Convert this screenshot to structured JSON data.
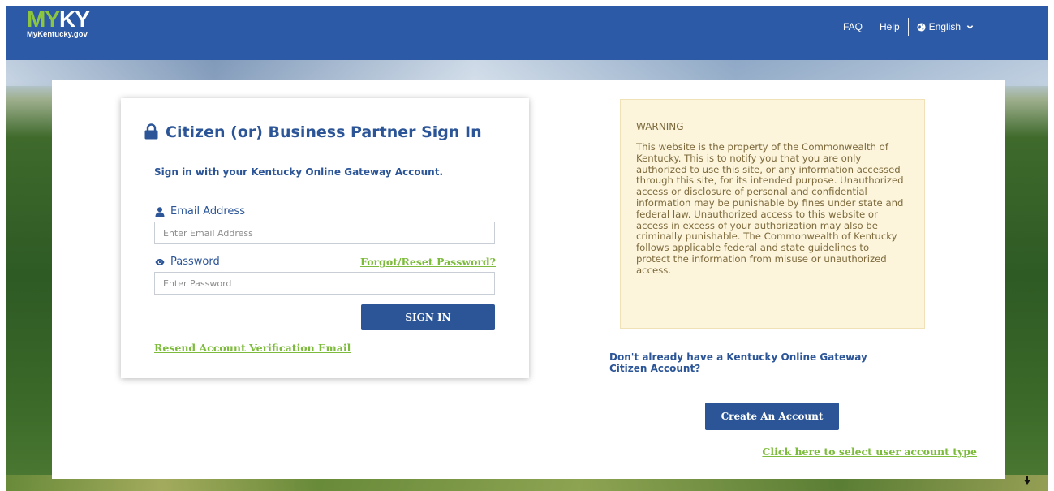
{
  "header": {
    "logo_my": "MY",
    "logo_ky": "KY",
    "logo_sub": "MyKentucky.gov",
    "nav": {
      "faq": "FAQ",
      "help": "Help",
      "language": "English"
    }
  },
  "signin": {
    "title": "Citizen (or) Business Partner Sign In",
    "subtitle": "Sign in with your Kentucky Online Gateway Account.",
    "email_label": "Email Address",
    "email_placeholder": "Enter Email Address",
    "email_value": "",
    "password_label": "Password",
    "password_placeholder": "Enter Password",
    "password_value": "",
    "forgot_link": "Forgot/Reset Password?",
    "signin_button": "SIGN IN",
    "resend_link": "Resend Account Verification Email"
  },
  "warning": {
    "title": "WARNING",
    "body": "This website is the property of the Commonwealth of Kentucky. This is to notify you that you are only authorized to use this site, or any information accessed through this site, for its intended purpose. Unauthorized access or disclosure of personal and confidential information may be punishable by fines under state and federal law. Unauthorized access to this website or access in excess of your authorization may also be criminally punishable. The Commonwealth of Kentucky follows applicable federal and state guidelines to protect the information from misuse or unauthorized access."
  },
  "register": {
    "prompt": "Don't already have a Kentucky Online Gateway Citizen Account?",
    "create_button": "Create An Account",
    "select_type_link": "Click here to select user account type"
  },
  "colors": {
    "primary": "#2b5597",
    "header": "#2d5aa6",
    "link_green": "#7dbb3c",
    "warning_bg": "#fcf5dc",
    "warning_text": "#7d6a3c"
  },
  "icons": [
    "lock-icon",
    "user-icon",
    "eye-icon",
    "globe-icon",
    "chevron-down-icon",
    "down-arrow-icon"
  ]
}
